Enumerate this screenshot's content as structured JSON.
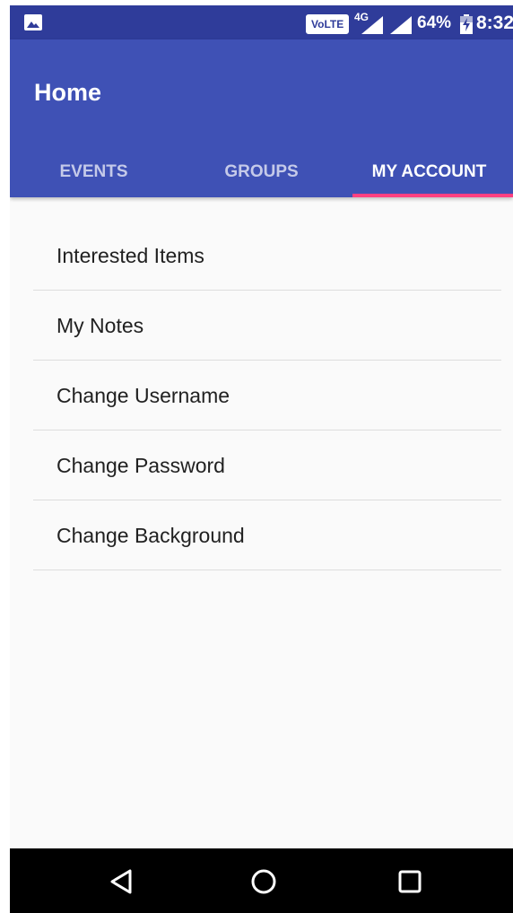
{
  "status_bar": {
    "volte_label": "VoLTE",
    "network_type": "4G",
    "battery_percent": "64%",
    "time": "8:32",
    "icons": [
      "image-notification-icon",
      "signal-icon",
      "signal-roaming-icon",
      "battery-charging-icon"
    ]
  },
  "app_bar": {
    "title": "Home",
    "tabs": [
      {
        "label": "EVENTS",
        "active": false
      },
      {
        "label": "GROUPS",
        "active": false
      },
      {
        "label": "MY ACCOUNT",
        "active": true
      }
    ]
  },
  "menu": {
    "items": [
      {
        "label": "Interested Items"
      },
      {
        "label": "My Notes"
      },
      {
        "label": "Change Username"
      },
      {
        "label": "Change Password"
      },
      {
        "label": "Change Background"
      }
    ]
  },
  "nav_bar": {
    "icons": [
      "back-icon",
      "home-icon",
      "recents-icon"
    ]
  },
  "colors": {
    "primary": "#3f51b5",
    "primary_dark": "#2f3c9a",
    "accent": "#ff4081",
    "background": "#fafafa"
  }
}
